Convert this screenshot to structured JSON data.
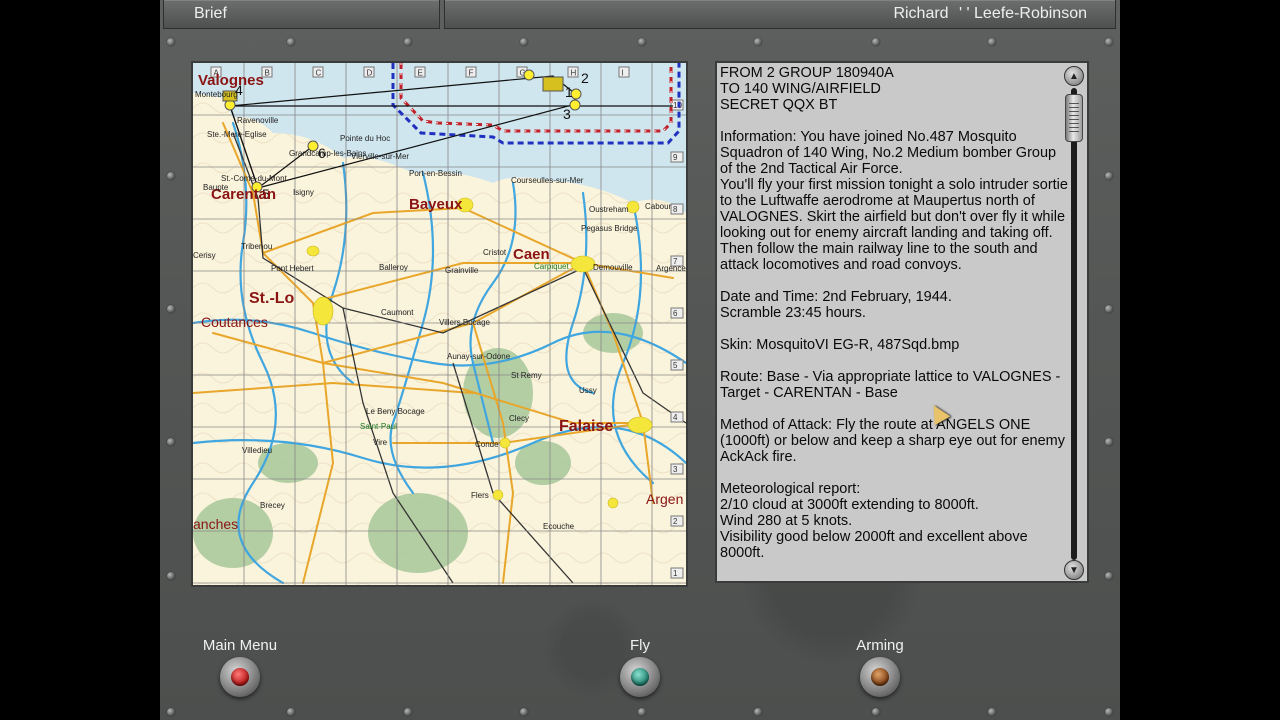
{
  "header": {
    "title": "Brief",
    "pilot_first": "Richard",
    "pilot_last": "' ' Leefe-Robinson"
  },
  "map": {
    "grid_columns": [
      "A",
      "B",
      "C",
      "D",
      "E",
      "F",
      "G",
      "H",
      "I"
    ],
    "grid_rows": [
      "10",
      "9",
      "8",
      "7",
      "6",
      "5",
      "4",
      "3",
      "2",
      "1"
    ],
    "towns_large": [
      "Valognes",
      "Carentan",
      "Bayeux",
      "Caen",
      "St.-Lo",
      "Coutances",
      "Falaise",
      "Argen",
      "anches"
    ],
    "towns_small": [
      "Montebourg",
      "Ravenoville",
      "Ste.-Mere-Eglise",
      "Pointe du Hoc",
      "Grandcamp-les-Bains",
      "Vierville-sur-Mer",
      "Port-en-Bessin",
      "St.-Come-du-Mont",
      "Baupte",
      "Isigny",
      "Courseulles-sur-Mer",
      "Cabour",
      "Oustreham",
      "Pegasus Bridge",
      "Tribenou",
      "Pont Hebert",
      "Balleroy",
      "Grainville",
      "Cristot",
      "Carpiquet",
      "Demouville",
      "Argence",
      "Cerisy",
      "Caumont",
      "Villers Bocage",
      "Aunay-sur-Odone",
      "St Remy",
      "Ussy",
      "Le Beny Bocage",
      "Clecy",
      "Saint-Paul",
      "Vire",
      "Conde",
      "Villedieu",
      "Flers",
      "Brecey",
      "Ecouche"
    ],
    "waypoints": [
      "1",
      "2",
      "3",
      "4",
      "5",
      "6"
    ]
  },
  "brief": {
    "paragraphs": [
      "FROM 2 GROUP 180940A\nTO 140 WING/AIRFIELD\nSECRET QQX BT",
      "Information:  You have joined No.487 Mosquito Squadron of 140 Wing, No.2 Medium bomber Group of the 2nd Tactical Air Force.\nYou'll fly your first mission tonight a solo intruder sortie to the Luftwaffe aerodrome at Maupertus north of VALOGNES. Skirt  the airfield but don't over fly it while looking out for enemy aircraft landing and taking off. Then follow the main railway line to the south and attack locomotives and road convoys.",
      "Date and Time:  2nd February, 1944.\nScramble 23:45 hours.",
      "Skin: MosquitoVI EG-R, 487Sqd.bmp",
      "Route:  Base - Via appropriate lattice to VALOGNES - Target - CARENTAN - Base",
      "Method of Attack: Fly the route at  ANGELS ONE (1000ft) or below and keep a sharp eye out for enemy  AckAck fire.",
      "Meteorological report:\n2/10 cloud at 3000ft extending to 8000ft.\nWind 280 at 5 knots.\nVisibility good below 2000ft and excellent above 8000ft."
    ]
  },
  "buttons": {
    "main_menu": "Main Menu",
    "fly": "Fly",
    "arming": "Arming"
  },
  "colors": {
    "map_land": "#fbf4dc",
    "sea": "#cfe6ee",
    "route_red": "#c0202a",
    "route_blue": "#2030c0",
    "town_text": "#8a1414"
  }
}
